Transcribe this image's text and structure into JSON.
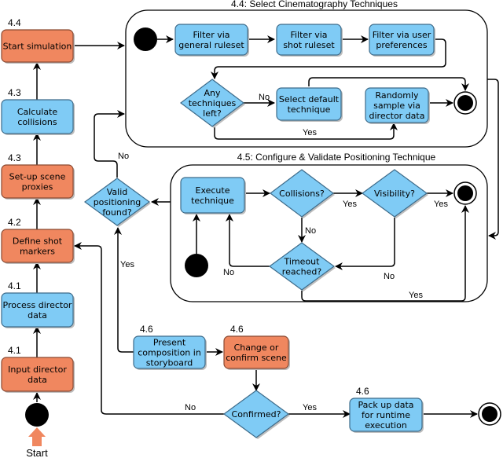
{
  "colors": {
    "process_blue": "#7fcbf5",
    "user_orange": "#f0875f",
    "stroke": "#000000"
  },
  "start_label": "Start",
  "left_column": [
    {
      "id": "start-simulation",
      "number": "4.4",
      "lines": [
        "Start simulation"
      ],
      "color": "orange"
    },
    {
      "id": "calculate-collisions",
      "number": "4.3",
      "lines": [
        "Calculate",
        "collisions"
      ],
      "color": "blue"
    },
    {
      "id": "setup-scene-proxies",
      "number": "4.3",
      "lines": [
        "Set-up scene",
        "proxies"
      ],
      "color": "orange"
    },
    {
      "id": "define-shot-markers",
      "number": "4.2",
      "lines": [
        "Define shot",
        "markers"
      ],
      "color": "orange"
    },
    {
      "id": "process-director-data",
      "number": "4.1",
      "lines": [
        "Process director",
        "data"
      ],
      "color": "blue"
    },
    {
      "id": "input-director-data",
      "number": "4.1",
      "lines": [
        "Input director",
        "data"
      ],
      "color": "orange"
    }
  ],
  "group_select": {
    "title": "4.4: Select Cinematography Techniques",
    "nodes": {
      "filter_general": [
        "Filter via",
        "general ruleset"
      ],
      "filter_shot": [
        "Filter via",
        "shot ruleset"
      ],
      "filter_user": [
        "Filter via user",
        "preferences"
      ],
      "any_left": [
        "Any",
        "techniques",
        "left?"
      ],
      "select_default": [
        "Select default",
        "technique"
      ],
      "random_sample": [
        "Randomly",
        "sample via",
        "director data"
      ]
    },
    "edge_labels": {
      "no": "No",
      "yes": "Yes"
    }
  },
  "group_validate": {
    "title": "4.5: Configure & Validate Positioning Technique",
    "nodes": {
      "execute": [
        "Execute",
        "technique"
      ],
      "collisions": [
        "Collisions?"
      ],
      "visibility": [
        "Visibility?"
      ],
      "timeout": [
        "Timeout",
        "reached?"
      ]
    },
    "edge_labels": {
      "collisions_yes": "Yes",
      "collisions_no": "No",
      "visibility_yes": "Yes",
      "visibility_no": "No",
      "timeout_no": "No",
      "timeout_yes": "Yes"
    }
  },
  "valid_positioning": {
    "lines": [
      "Valid",
      "positioning",
      "found?"
    ],
    "no_label": "No",
    "yes_label": "Yes"
  },
  "bottom": {
    "present": {
      "number": "4.6",
      "lines": [
        "Present",
        "composition in",
        "storyboard"
      ]
    },
    "change": {
      "number": "4.6",
      "lines": [
        "Change or",
        "confirm scene"
      ]
    },
    "confirmed": {
      "lines": [
        "Confirmed?"
      ],
      "no_label": "No",
      "yes_label": "Yes"
    },
    "pack": {
      "number": "4.6",
      "lines": [
        "Pack up data",
        "for runtime",
        "execution"
      ]
    }
  }
}
